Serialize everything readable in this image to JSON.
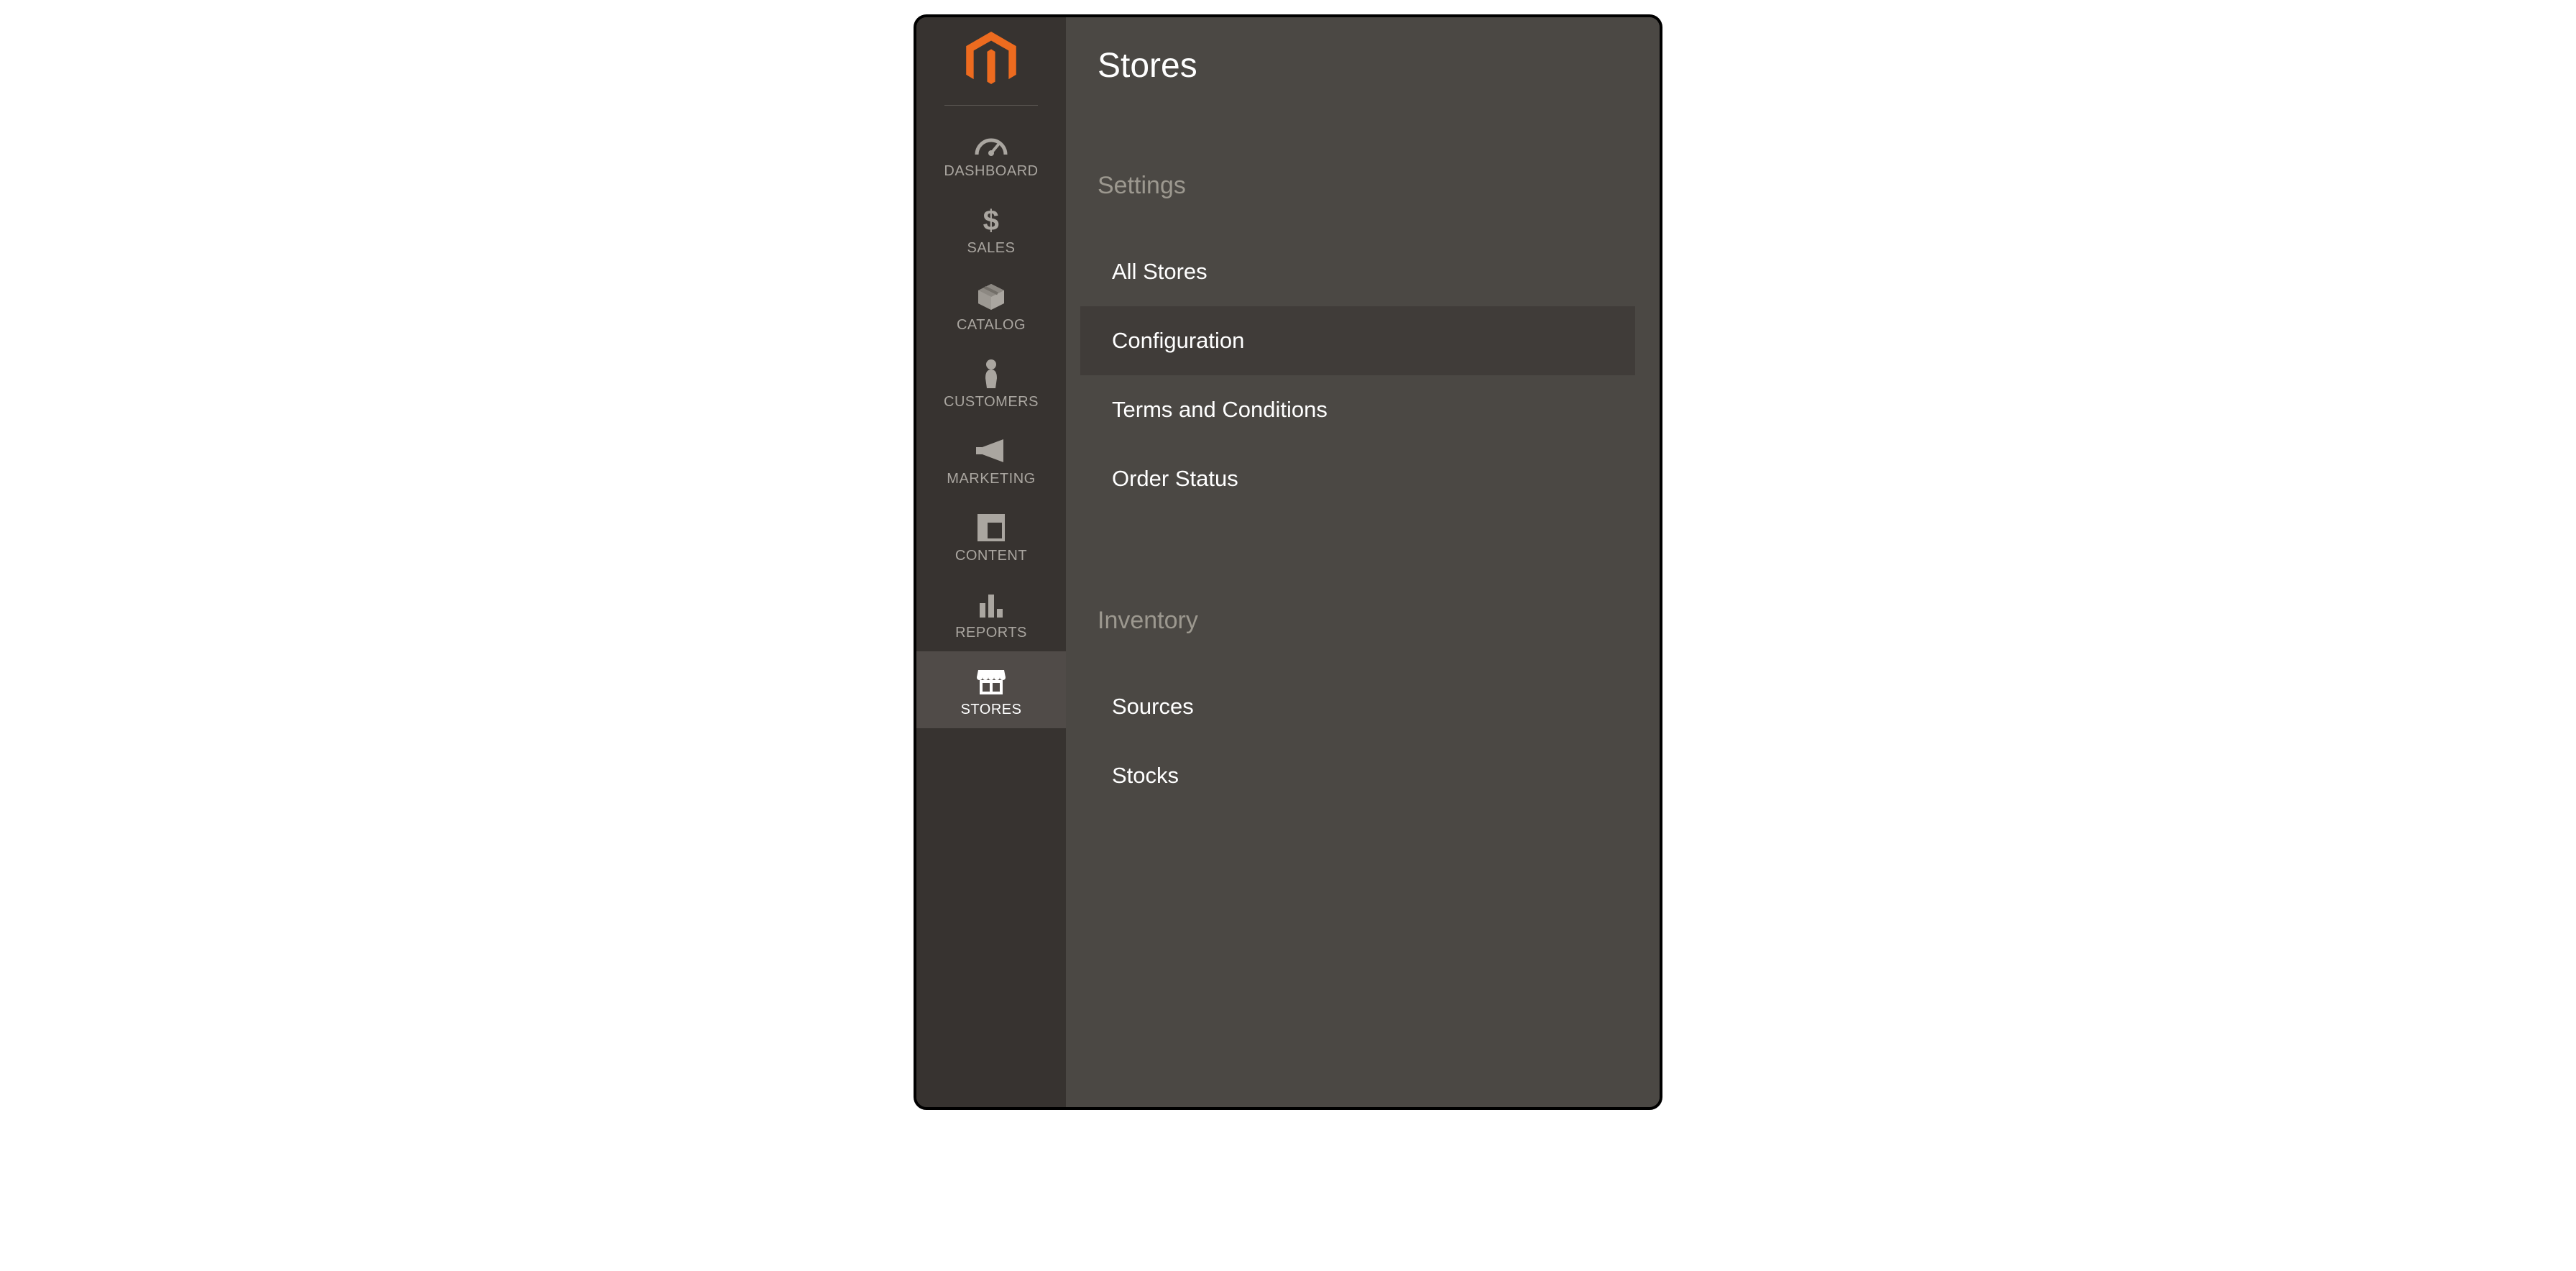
{
  "sidebar": {
    "items": [
      {
        "label": "DASHBOARD",
        "icon": "dashboard-icon",
        "active": false
      },
      {
        "label": "SALES",
        "icon": "dollar-icon",
        "active": false
      },
      {
        "label": "CATALOG",
        "icon": "box-icon",
        "active": false
      },
      {
        "label": "CUSTOMERS",
        "icon": "person-icon",
        "active": false
      },
      {
        "label": "MARKETING",
        "icon": "megaphone-icon",
        "active": false
      },
      {
        "label": "CONTENT",
        "icon": "layout-icon",
        "active": false
      },
      {
        "label": "REPORTS",
        "icon": "bar-chart-icon",
        "active": false
      },
      {
        "label": "STORES",
        "icon": "storefront-icon",
        "active": true
      }
    ]
  },
  "flyout": {
    "title": "Stores",
    "sections": [
      {
        "heading": "Settings",
        "items": [
          {
            "label": "All Stores",
            "hovered": false
          },
          {
            "label": "Configuration",
            "hovered": true
          },
          {
            "label": "Terms and Conditions",
            "hovered": false
          },
          {
            "label": "Order Status",
            "hovered": false
          }
        ]
      },
      {
        "heading": "Inventory",
        "items": [
          {
            "label": "Sources",
            "hovered": false
          },
          {
            "label": "Stocks",
            "hovered": false
          }
        ]
      }
    ]
  }
}
